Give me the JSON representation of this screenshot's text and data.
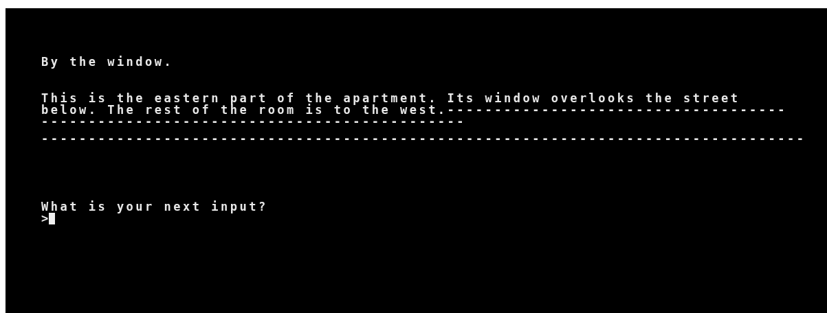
{
  "location_title": "By the window.",
  "description_lines": [
    "This is the eastern part of the apartment. Its window overlooks the street",
    "below. The rest of the room is to the west.------------------------------------",
    "---------------------------------------------",
    "---------------------------------------------------------------------------------"
  ],
  "prompt": "What is your next input?",
  "input": {
    "prompt_char": ">"
  }
}
